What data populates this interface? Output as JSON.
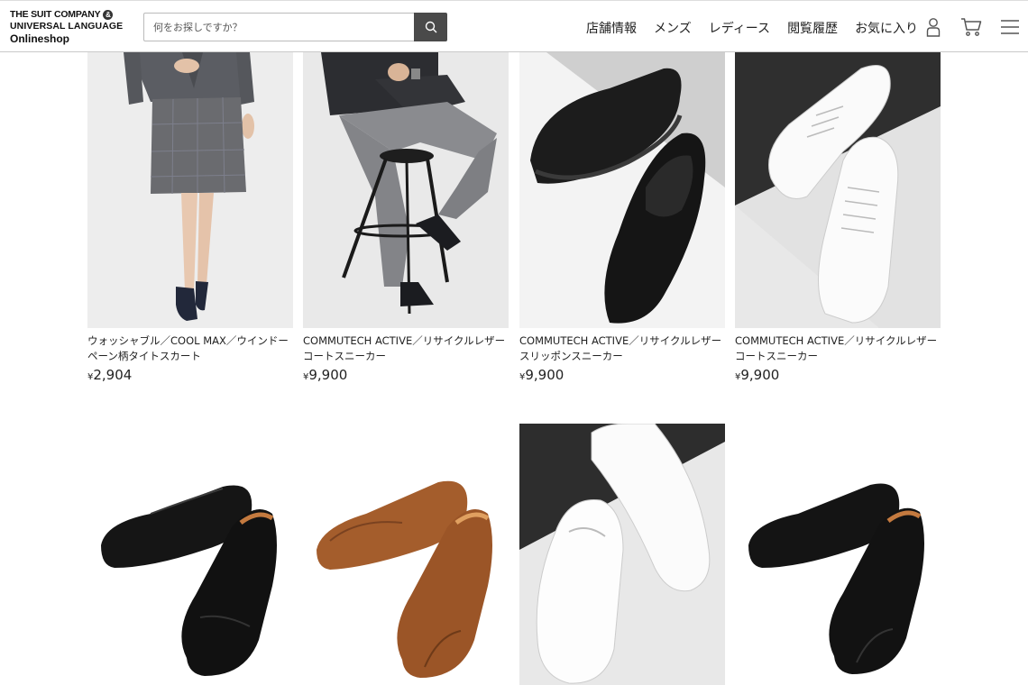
{
  "header": {
    "logo": {
      "line1": "THE SUIT COMPANY",
      "amp": "&",
      "line2": "UNIVERSAL LANGUAGE",
      "line3": "Onlineshop"
    },
    "search": {
      "placeholder": "何をお探しですか？",
      "value": ""
    },
    "nav": [
      "店舗情報",
      "メンズ",
      "レディース",
      "閲覧履歴",
      "お気に入り"
    ]
  },
  "products": [
    {
      "name": "ウォッシャブル／COOL MAX／ウインドーペーン柄タイトスカート",
      "currency": "¥",
      "price": "2,904",
      "image": "skirt-photo"
    },
    {
      "name": "COMMUTECH ACTIVE／リサイクルレザーコートスニーカー",
      "currency": "¥",
      "price": "9,900",
      "image": "model-sneaker-photo"
    },
    {
      "name": "COMMUTECH ACTIVE／リサイクルレザー スリッポンスニーカー",
      "currency": "¥",
      "price": "9,900",
      "image": "black-slipon-photo"
    },
    {
      "name": "COMMUTECH ACTIVE／リサイクルレザーコートスニーカー",
      "currency": "¥",
      "price": "9,900",
      "image": "white-sneaker-photo"
    },
    {
      "name": "",
      "currency": "",
      "price": "",
      "image": "black-captoe-shoes-photo"
    },
    {
      "name": "",
      "currency": "",
      "price": "",
      "image": "brown-uchip-shoes-photo"
    },
    {
      "name": "",
      "currency": "",
      "price": "",
      "image": "white-slipon-photo"
    },
    {
      "name": "",
      "currency": "",
      "price": "",
      "image": "black-uchip-shoes-photo"
    }
  ]
}
